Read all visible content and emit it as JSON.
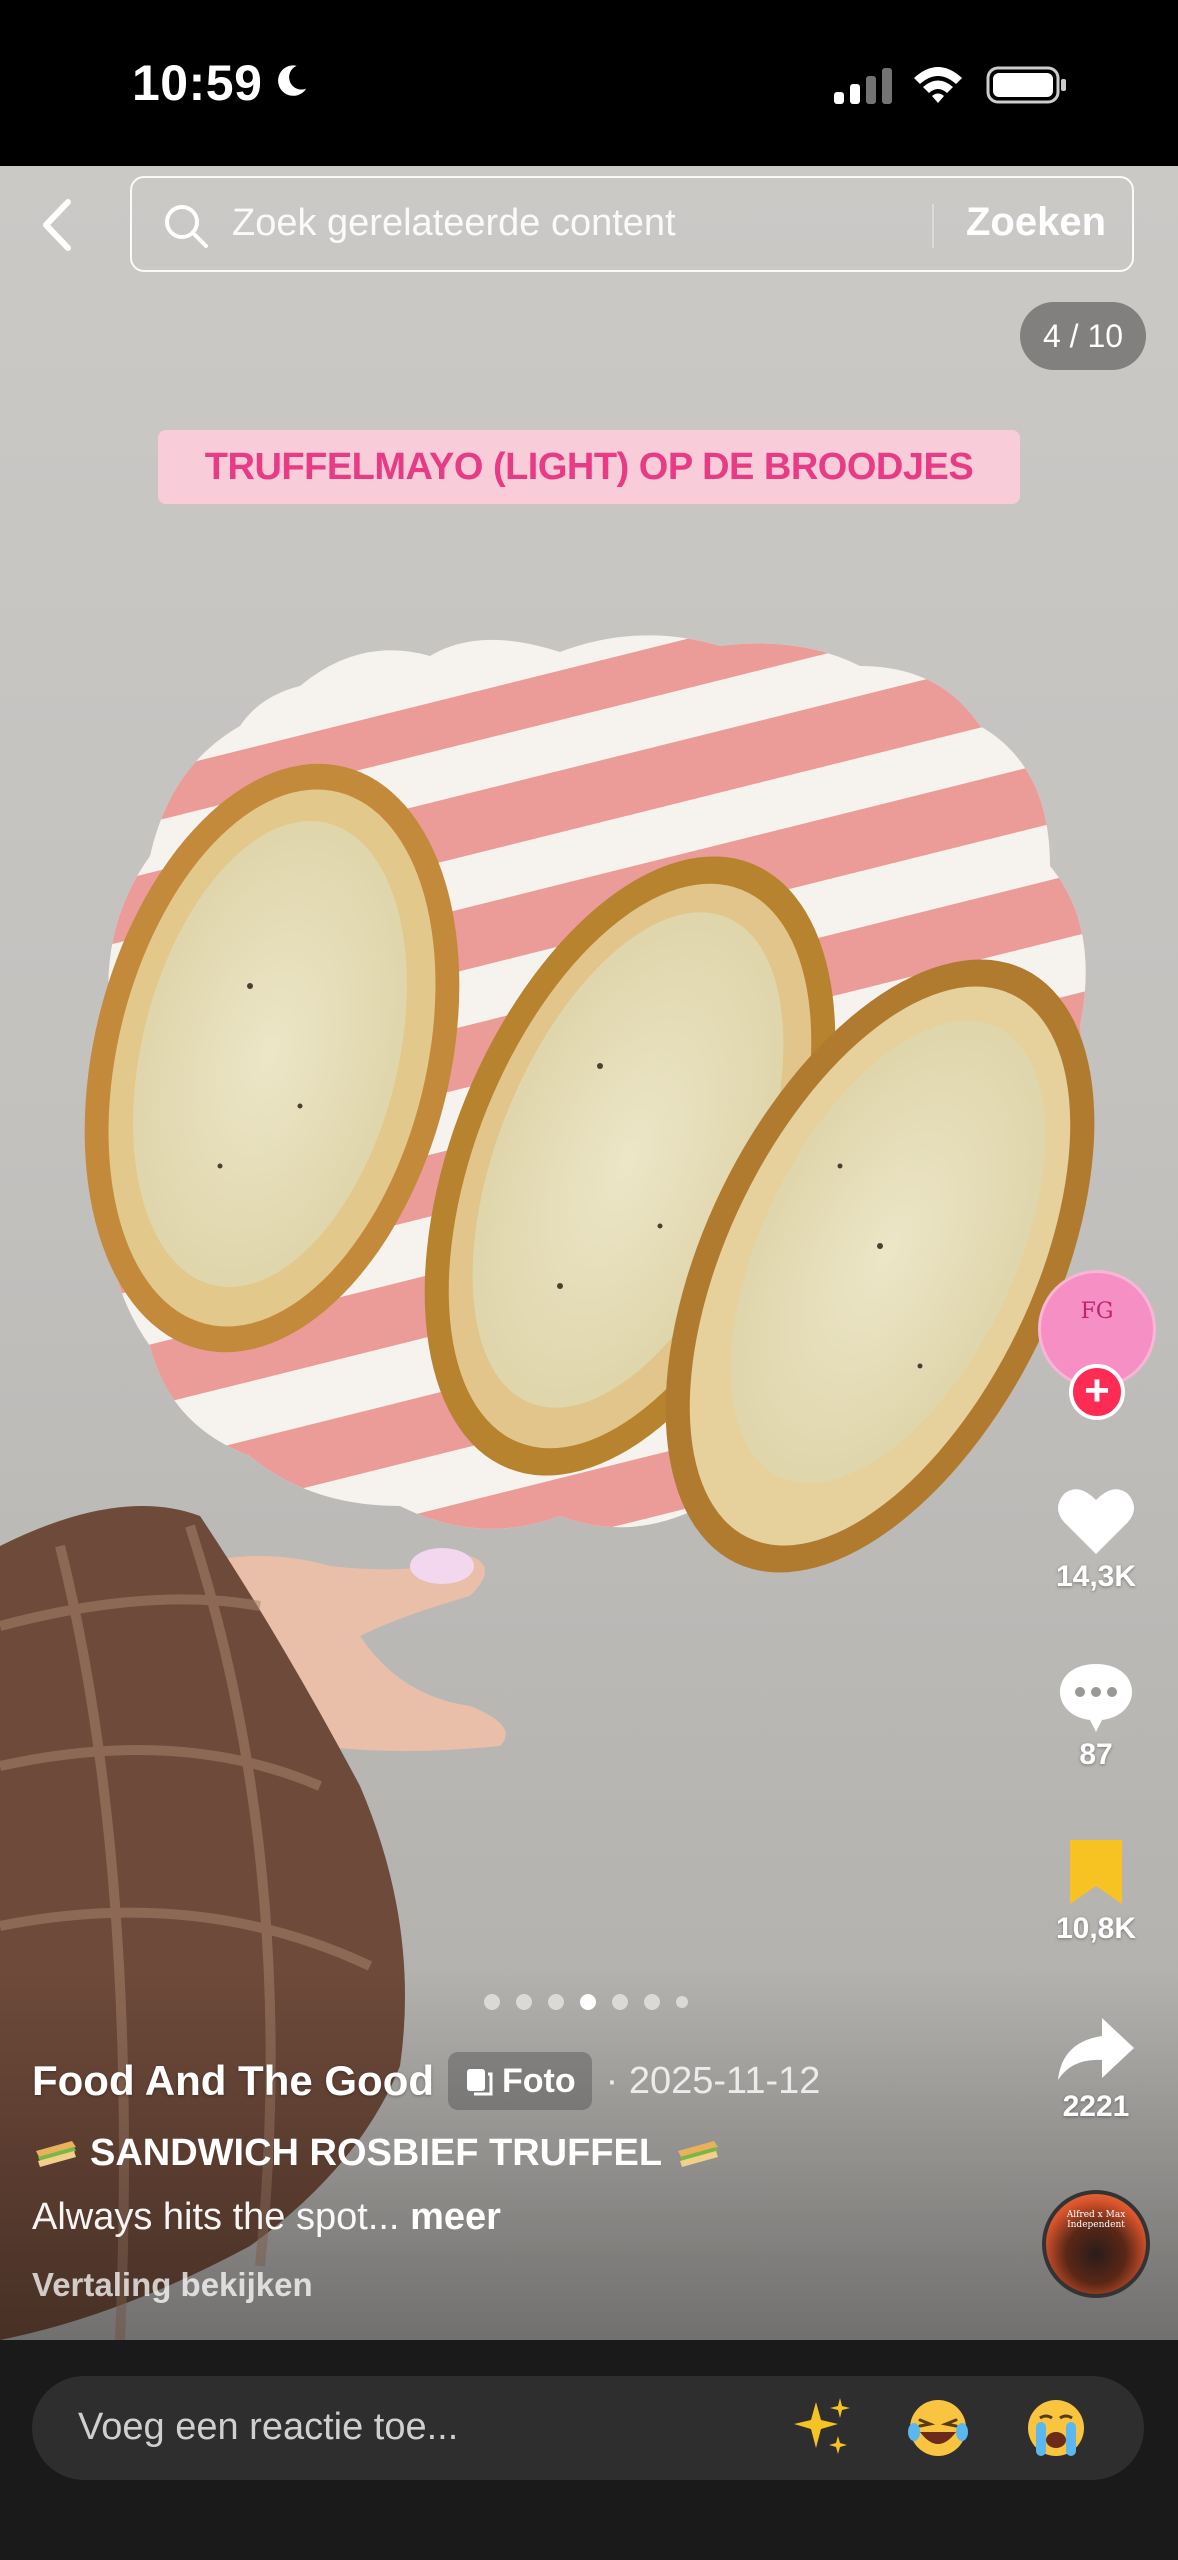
{
  "status_bar": {
    "time": "10:59"
  },
  "search": {
    "placeholder": "Zoek gerelateerde content",
    "button_label": "Zoeken"
  },
  "slide_counter": "4 / 10",
  "overlay_text": "TRUFFELMAYO (LIGHT) OP DE BROODJES",
  "rail": {
    "avatar_text": "FG",
    "likes": "14,3K",
    "comments": "87",
    "saves": "10,8K",
    "shares": "2221",
    "music_disc_text": "Alfred x Max Independent"
  },
  "carousel": {
    "total_dots": 7,
    "active_index": 3
  },
  "post": {
    "author": "Food And The Good",
    "badge_label": "Foto",
    "date": "· 2025-11-12",
    "title": "SANDWICH ROSBIEF TRUFFEL",
    "body": "Always hits the spot...",
    "more_label": "meer",
    "translate_label": "Vertaling bekijken"
  },
  "comment_bar": {
    "placeholder": "Voeg een reactie toe..."
  },
  "colors": {
    "accent_pink": "#fe2c55",
    "label_pink": "#e83b86",
    "save_yellow": "#f7c322"
  }
}
